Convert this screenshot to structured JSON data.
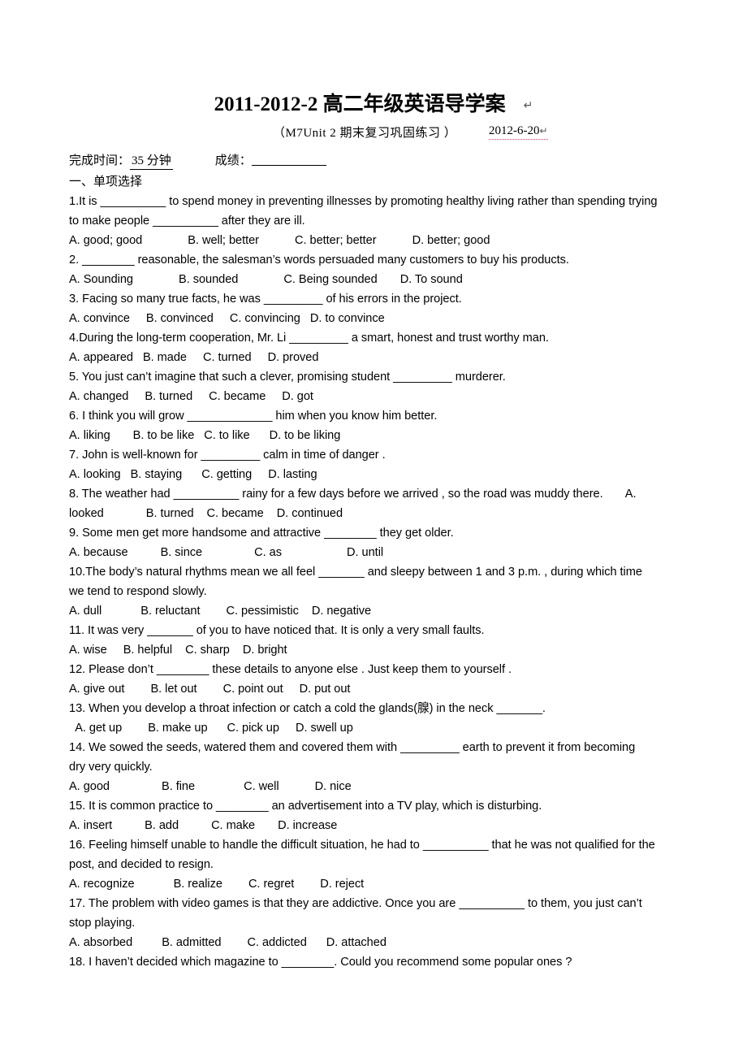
{
  "document": {
    "title": "2011-2012-2 高二年级英语导学案",
    "title_pilcrow": "↵",
    "subtitle": "（M7Unit 2  期末复习巩固练习  ）",
    "date": "2012-6-20",
    "date_pilcrow": "↵",
    "info": {
      "time_label": "完成时间：",
      "time_value": "35 分钟",
      "score_label": "成绩：",
      "score_value": ""
    },
    "section_heading": "一、单项选择",
    "watermark_color": "#f3dbe7",
    "date_underline_color": "#d23c6e"
  },
  "questions_lines": [
    "1.It is __________ to spend money in preventing illnesses by promoting healthy living rather than spending trying",
    "to make people __________ after they are ill.",
    "A. good; good              B. well; better           C. better; better           D. better; good",
    "2. ________ reasonable, the salesman’s words persuaded many customers to buy his products.",
    "A. Sounding              B. sounded              C. Being sounded       D. To sound",
    "3. Facing so many true facts, he was _________ of his errors in the project.",
    "A. convince     B. convinced     C. convincing   D. to convince",
    "4.During the long-term cooperation, Mr. Li _________ a smart, honest and trust worthy man.",
    "A. appeared   B. made     C. turned     D. proved",
    "5. You just can’t imagine that such a clever, promising student _________ murderer.",
    "A. changed     B. turned     C. became     D. got",
    "6. I think you will grow _____________ him when you know him better.",
    "A. liking       B. to be like   C. to like      D. to be liking",
    "7. John is well-known for _________ calm in time of danger .",
    "A. looking   B. staying      C. getting     D. lasting",
    "8. The weather had __________ rainy for a few days before we arrived , so the road was muddy there.       A.",
    "looked             B. turned    C. became    D. continued",
    "9. Some men get more handsome and attractive ________ they get older.",
    "A. because          B. since                C. as                    D. until",
    "10.The body’s natural rhythms mean we all feel _______ and sleepy between 1 and 3 p.m. , during which time",
    "we tend to respond slowly.",
    "A. dull            B. reluctant        C. pessimistic    D. negative",
    "11. It was very _______ of you to have noticed that. It is only a very small faults.",
    "A. wise     B. helpful    C. sharp    D. bright",
    "12. Please don’t ________ these details to anyone else . Just keep them to yourself .",
    "A. give out        B. let out        C. point out     D. put out",
    "13. When you develop a throat infection or catch a cold the glands(腺) in the neck _______.",
    "  A. get up        B. make up      C. pick up     D. swell up",
    "14. We sowed the seeds, watered them and covered them with _________ earth to prevent it from becoming",
    "dry very quickly.",
    "A. good                B. fine               C. well           D. nice",
    "15. It is common practice to ________ an advertisement into a TV play, which is disturbing.",
    "A. insert          B. add          C. make       D. increase",
    "16. Feeling himself unable to handle the difficult situation, he had to __________ that he was not qualified for the",
    "post, and decided to resign.",
    "A. recognize            B. realize        C. regret        D. reject",
    "17. The problem with video games is that they are addictive. Once you are __________ to them, you just can’t",
    "stop playing.",
    "A. absorbed         B. admitted        C. addicted      D. attached",
    "18. I haven’t decided which magazine to ________. Could you recommend some popular ones ?"
  ],
  "watermark_marks": [
    "",
    "",
    "",
    ""
  ]
}
